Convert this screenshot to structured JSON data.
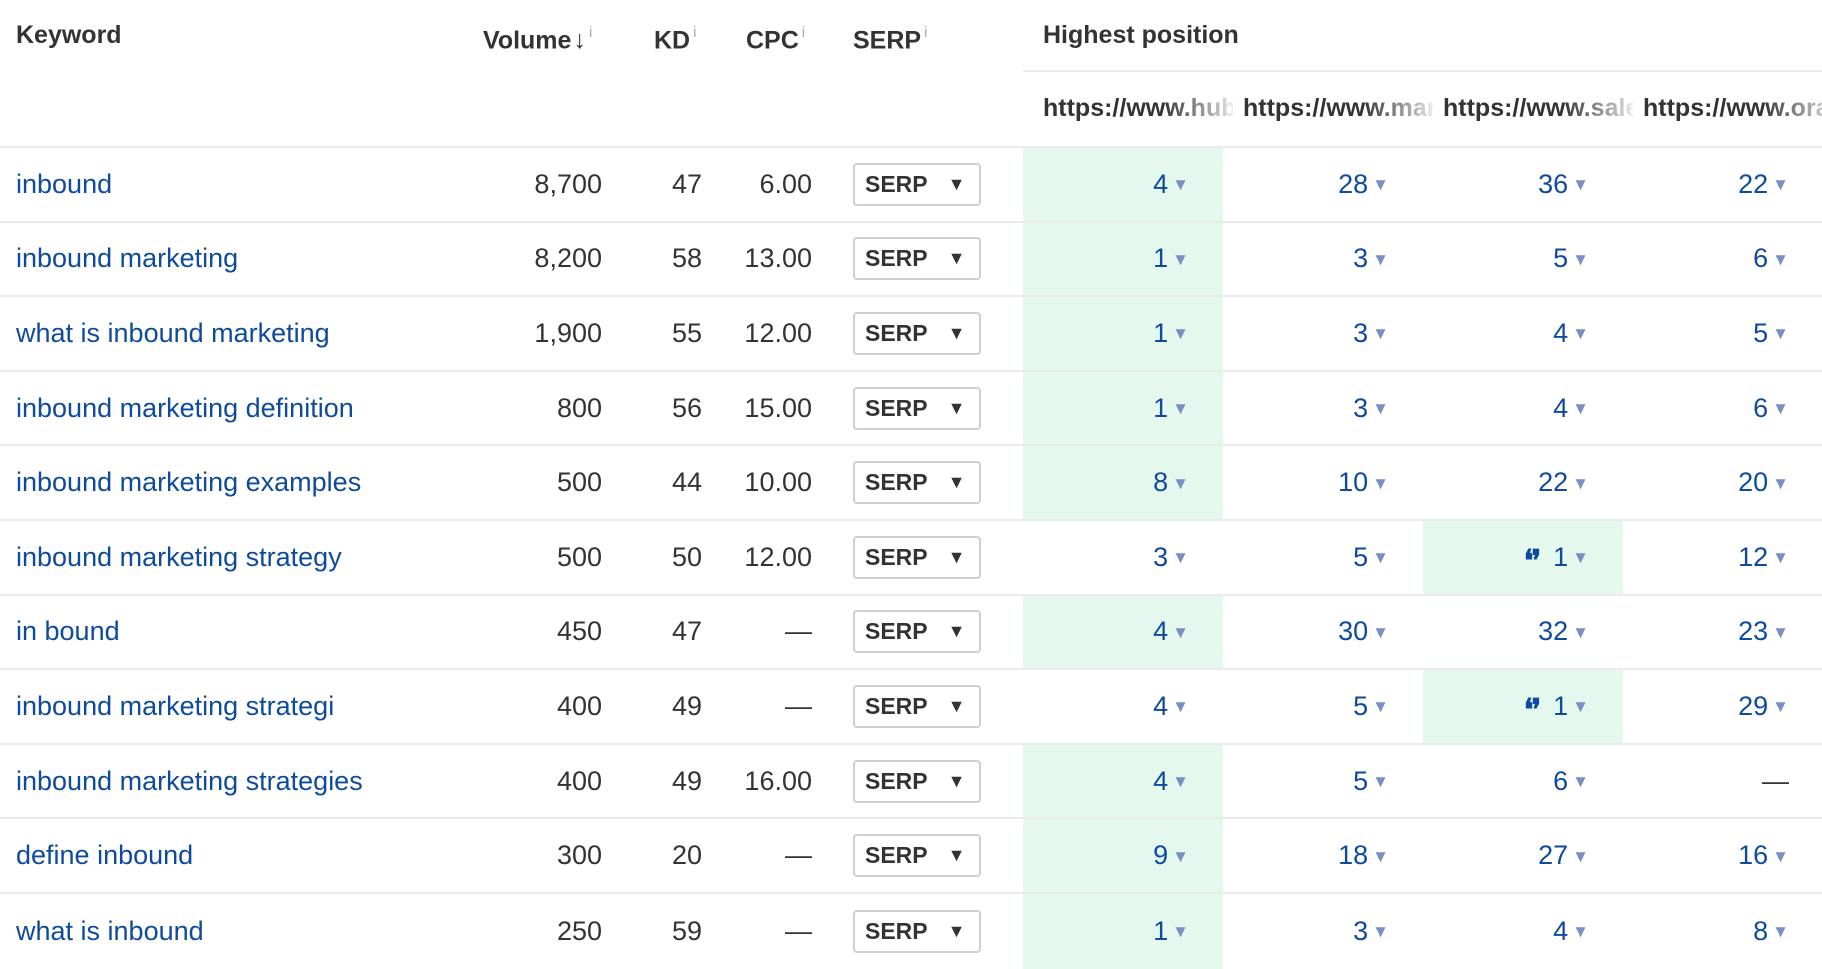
{
  "header": {
    "keyword": "Keyword",
    "volume": "Volume",
    "volume_sort_icon": "↓",
    "kd": "KD",
    "cpc": "CPC",
    "serp": "SERP",
    "info_icon": "i",
    "highest_position": "Highest position",
    "urls": [
      "https://www.hubspot.com",
      "https://www.marketo.com",
      "https://www.salesforce.com",
      "https://www.oracle.com"
    ]
  },
  "serp_button_label": "SERP",
  "serp_button_caret": "▼",
  "position_caret": "▼",
  "quote_icon": "❛❜",
  "colors": {
    "link": "#0e4a9e",
    "highlight": "#e4f8ee",
    "caret": "#7b8fc4"
  },
  "rows": [
    {
      "keyword": "inbound",
      "volume": "8,700",
      "kd": "47",
      "cpc": "6.00",
      "positions": [
        {
          "v": "4",
          "hl": true
        },
        {
          "v": "28"
        },
        {
          "v": "36"
        },
        {
          "v": "22"
        }
      ]
    },
    {
      "keyword": "inbound marketing",
      "volume": "8,200",
      "kd": "58",
      "cpc": "13.00",
      "positions": [
        {
          "v": "1",
          "hl": true
        },
        {
          "v": "3"
        },
        {
          "v": "5"
        },
        {
          "v": "6"
        }
      ]
    },
    {
      "keyword": "what is inbound marketing",
      "volume": "1,900",
      "kd": "55",
      "cpc": "12.00",
      "positions": [
        {
          "v": "1",
          "hl": true
        },
        {
          "v": "3"
        },
        {
          "v": "4"
        },
        {
          "v": "5"
        }
      ]
    },
    {
      "keyword": "inbound marketing definition",
      "volume": "800",
      "kd": "56",
      "cpc": "15.00",
      "positions": [
        {
          "v": "1",
          "hl": true
        },
        {
          "v": "3"
        },
        {
          "v": "4"
        },
        {
          "v": "6"
        }
      ]
    },
    {
      "keyword": "inbound marketing examples",
      "volume": "500",
      "kd": "44",
      "cpc": "10.00",
      "positions": [
        {
          "v": "8",
          "hl": true
        },
        {
          "v": "10"
        },
        {
          "v": "22"
        },
        {
          "v": "20"
        }
      ]
    },
    {
      "keyword": "inbound marketing strategy",
      "volume": "500",
      "kd": "50",
      "cpc": "12.00",
      "positions": [
        {
          "v": "3"
        },
        {
          "v": "5"
        },
        {
          "v": "1",
          "hl": true,
          "featured": true
        },
        {
          "v": "12"
        }
      ]
    },
    {
      "keyword": "in bound",
      "volume": "450",
      "kd": "47",
      "cpc": "—",
      "positions": [
        {
          "v": "4",
          "hl": true
        },
        {
          "v": "30"
        },
        {
          "v": "32"
        },
        {
          "v": "23"
        }
      ]
    },
    {
      "keyword": "inbound marketing strategi",
      "volume": "400",
      "kd": "49",
      "cpc": "—",
      "positions": [
        {
          "v": "4"
        },
        {
          "v": "5"
        },
        {
          "v": "1",
          "hl": true,
          "featured": true
        },
        {
          "v": "29"
        }
      ]
    },
    {
      "keyword": "inbound marketing strategies",
      "volume": "400",
      "kd": "49",
      "cpc": "16.00",
      "positions": [
        {
          "v": "4",
          "hl": true
        },
        {
          "v": "5"
        },
        {
          "v": "6"
        },
        {
          "v": "—",
          "none": true
        }
      ]
    },
    {
      "keyword": "define inbound",
      "volume": "300",
      "kd": "20",
      "cpc": "—",
      "positions": [
        {
          "v": "9",
          "hl": true
        },
        {
          "v": "18"
        },
        {
          "v": "27"
        },
        {
          "v": "16"
        }
      ]
    },
    {
      "keyword": "what is inbound",
      "volume": "250",
      "kd": "59",
      "cpc": "—",
      "positions": [
        {
          "v": "1",
          "hl": true
        },
        {
          "v": "3"
        },
        {
          "v": "4"
        },
        {
          "v": "8"
        }
      ]
    }
  ]
}
